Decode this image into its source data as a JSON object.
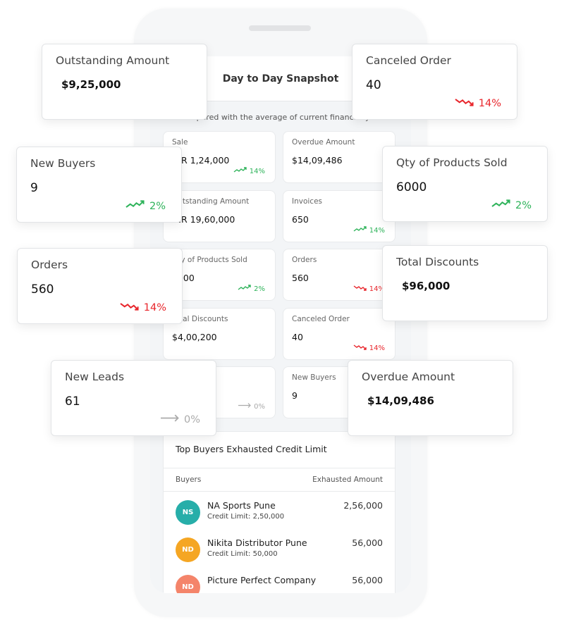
{
  "header": {
    "title": "Day to Day Snapshot",
    "subtitle": "Compared with the average of current financial year"
  },
  "colors": {
    "up": "#2eb35a",
    "down": "#e8252b",
    "flat": "#aaaaaa"
  },
  "inner_cards": [
    {
      "label": "Sale",
      "value": "INR 1,24,000",
      "trend": "up",
      "change": "14%"
    },
    {
      "label": "Overdue Amount",
      "value": "$14,09,486",
      "trend": "",
      "change": ""
    },
    {
      "label": "Outstanding Amount",
      "value": "INR 19,60,000",
      "trend": "",
      "change": ""
    },
    {
      "label": "Invoices",
      "value": "650",
      "trend": "up",
      "change": "14%"
    },
    {
      "label": "Qty of Products Sold",
      "value": "6000",
      "trend": "up",
      "change": "2%"
    },
    {
      "label": "Orders",
      "value": "560",
      "trend": "down",
      "change": "14%"
    },
    {
      "label": "Total Discounts",
      "value": "$4,00,200",
      "trend": "",
      "change": ""
    },
    {
      "label": "Canceled Order",
      "value": "40",
      "trend": "down",
      "change": "14%"
    },
    {
      "label": "New Leads",
      "value": "61",
      "trend": "flat",
      "change": "0%"
    },
    {
      "label": "New Buyers",
      "value": "9",
      "trend": "",
      "change": ""
    }
  ],
  "buyers_panel": {
    "title": "Top Buyers Exhausted Credit Limit",
    "col_buyers": "Buyers",
    "col_amount": "Exhausted Amount",
    "rows": [
      {
        "initials": "NS",
        "color": "#27aea9",
        "name": "NA Sports Pune",
        "credit": "Credit Limit: 2,50,000",
        "amount": "2,56,000"
      },
      {
        "initials": "ND",
        "color": "#f5a623",
        "name": "Nikita Distributor Pune",
        "credit": "Credit Limit: 50,000",
        "amount": "56,000"
      },
      {
        "initials": "ND",
        "color": "#f4846a",
        "name": "Picture Perfect Company",
        "credit": "",
        "amount": "56,000"
      }
    ]
  },
  "overlay_cards": [
    {
      "label": "Outstanding Amount",
      "value": "$9,25,000",
      "bold": true,
      "trend": "",
      "change": ""
    },
    {
      "label": "Canceled Order",
      "value": "40",
      "bold": false,
      "trend": "down",
      "change": "14%"
    },
    {
      "label": "New Buyers",
      "value": "9",
      "bold": false,
      "trend": "up",
      "change": "2%"
    },
    {
      "label": "Qty of Products Sold",
      "value": "6000",
      "bold": false,
      "trend": "up",
      "change": "2%"
    },
    {
      "label": "Orders",
      "value": "560",
      "bold": false,
      "trend": "down",
      "change": "14%"
    },
    {
      "label": "Total Discounts",
      "value": "$96,000",
      "bold": true,
      "trend": "",
      "change": ""
    },
    {
      "label": "New Leads",
      "value": "61",
      "bold": false,
      "trend": "flat",
      "change": "0%"
    },
    {
      "label": "Overdue Amount",
      "value": "$14,09,486",
      "bold": true,
      "trend": "",
      "change": ""
    }
  ]
}
